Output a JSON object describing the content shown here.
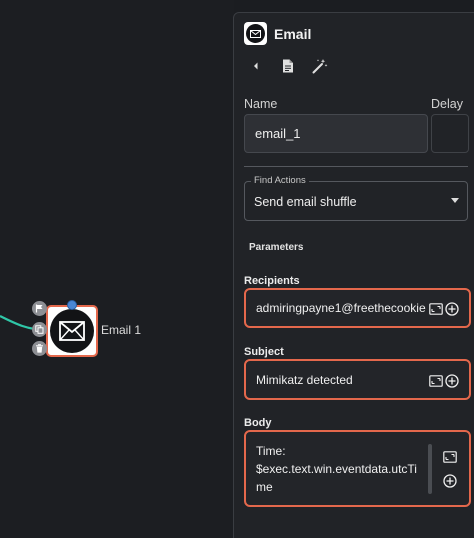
{
  "node": {
    "label": "Email 1",
    "icon": "envelope-icon",
    "mini_icons": [
      "flag-icon",
      "copy-icon",
      "trash-icon"
    ],
    "edge_color": "#2fc7a8",
    "border_color": "#e4684c"
  },
  "panel": {
    "title": "Email",
    "header_icon": "envelope-icon",
    "toolbar": [
      "back-icon",
      "document-icon",
      "magic-wand-icon"
    ],
    "name_label": "Name",
    "name_value": "email_1",
    "delay_label": "Delay",
    "delay_value": "",
    "find_actions_label": "Find Actions",
    "find_actions_value": "Send email shuffle",
    "parameters_title": "Parameters",
    "recipients_label": "Recipients",
    "recipients_value": "admiringpayne1@freethecookie",
    "subject_label": "Subject",
    "subject_value": "Mimikatz detected",
    "body_label": "Body",
    "body_lines": [
      "Time:",
      "$exec.text.win.eventdata.utcTi",
      "me"
    ]
  }
}
